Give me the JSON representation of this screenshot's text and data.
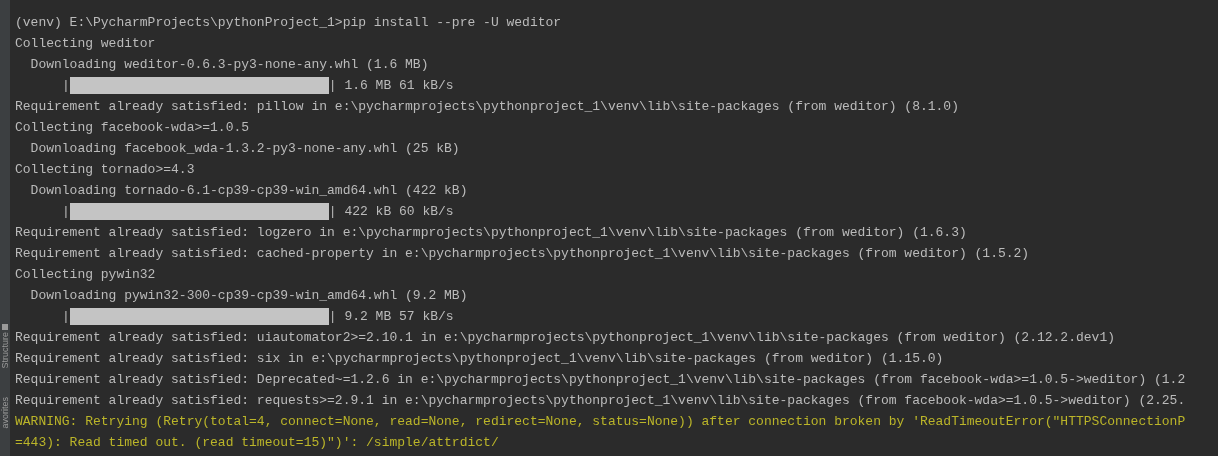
{
  "side_panel": {
    "tabs": [
      {
        "label": "Structure"
      },
      {
        "label": "avorites"
      }
    ]
  },
  "terminal": {
    "lines": [
      {
        "kind": "text",
        "text": "(venv) E:\\PycharmProjects\\pythonProject_1>pip install --pre -U weditor"
      },
      {
        "kind": "text",
        "text": "Collecting weditor"
      },
      {
        "kind": "text",
        "text": "  Downloading weditor-0.6.3-py3-none-any.whl (1.6 MB)"
      },
      {
        "kind": "progress",
        "lead": "|",
        "level": 1,
        "tail": "| 1.6 MB 61 kB/s"
      },
      {
        "kind": "text",
        "text": "Requirement already satisfied: pillow in e:\\pycharmprojects\\pythonproject_1\\venv\\lib\\site-packages (from weditor) (8.1.0)"
      },
      {
        "kind": "text",
        "text": "Collecting facebook-wda>=1.0.5"
      },
      {
        "kind": "text",
        "text": "  Downloading facebook_wda-1.3.2-py3-none-any.whl (25 kB)"
      },
      {
        "kind": "text",
        "text": "Collecting tornado>=4.3"
      },
      {
        "kind": "text",
        "text": "  Downloading tornado-6.1-cp39-cp39-win_amd64.whl (422 kB)"
      },
      {
        "kind": "progress",
        "lead": "|",
        "level": 1,
        "tail": "| 422 kB 60 kB/s"
      },
      {
        "kind": "text",
        "text": "Requirement already satisfied: logzero in e:\\pycharmprojects\\pythonproject_1\\venv\\lib\\site-packages (from weditor) (1.6.3)"
      },
      {
        "kind": "text",
        "text": "Requirement already satisfied: cached-property in e:\\pycharmprojects\\pythonproject_1\\venv\\lib\\site-packages (from weditor) (1.5.2)"
      },
      {
        "kind": "text",
        "text": "Collecting pywin32"
      },
      {
        "kind": "text",
        "text": "  Downloading pywin32-300-cp39-cp39-win_amd64.whl (9.2 MB)"
      },
      {
        "kind": "progress",
        "lead": "|",
        "level": 1,
        "tail": "| 9.2 MB 57 kB/s"
      },
      {
        "kind": "text",
        "text": "Requirement already satisfied: uiautomator2>=2.10.1 in e:\\pycharmprojects\\pythonproject_1\\venv\\lib\\site-packages (from weditor) (2.12.2.dev1)"
      },
      {
        "kind": "text",
        "text": "Requirement already satisfied: six in e:\\pycharmprojects\\pythonproject_1\\venv\\lib\\site-packages (from weditor) (1.15.0)"
      },
      {
        "kind": "text",
        "text": "Requirement already satisfied: Deprecated~=1.2.6 in e:\\pycharmprojects\\pythonproject_1\\venv\\lib\\site-packages (from facebook-wda>=1.0.5->weditor) (1.2"
      },
      {
        "kind": "text",
        "text": "Requirement already satisfied: requests>=2.9.1 in e:\\pycharmprojects\\pythonproject_1\\venv\\lib\\site-packages (from facebook-wda>=1.0.5->weditor) (2.25."
      },
      {
        "kind": "warning",
        "text": "WARNING: Retrying (Retry(total=4, connect=None, read=None, redirect=None, status=None)) after connection broken by 'ReadTimeoutError(\"HTTPSConnectionP"
      },
      {
        "kind": "warning",
        "text": "=443): Read timed out. (read timeout=15)\")': /simple/attrdict/"
      }
    ]
  }
}
